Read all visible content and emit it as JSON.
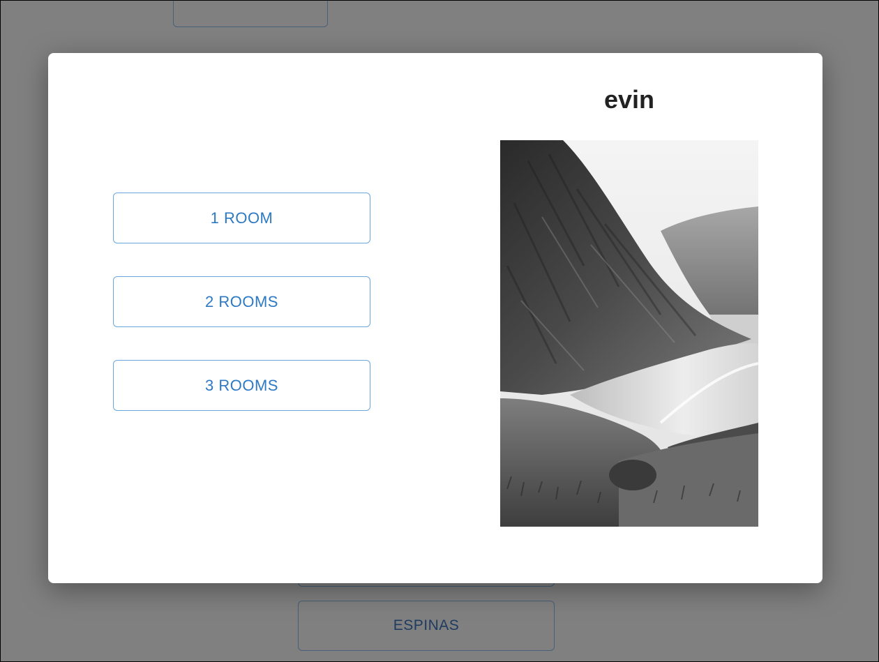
{
  "background": {
    "top_button_label": "",
    "hidden_button_label": "",
    "espinas_button_label": "ESPINAS"
  },
  "modal": {
    "title": "evin",
    "room_options": [
      {
        "label": "1 ROOM"
      },
      {
        "label": "2 ROOMS"
      },
      {
        "label": "3 ROOMS"
      }
    ],
    "photo": {
      "subject": "black-and-white coastal cliff and beach landscape"
    }
  },
  "colors": {
    "overlay": "#808080",
    "modal_background": "#ffffff",
    "button_text": "#2d79c4",
    "button_border": "#6aa6dc",
    "title_text": "#222222"
  }
}
